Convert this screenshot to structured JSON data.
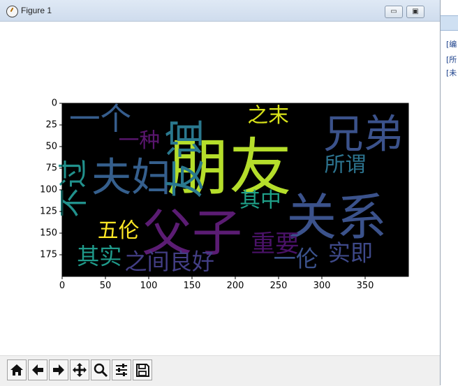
{
  "window": {
    "title": "Figure 1",
    "buttons": {
      "minimize": "▭",
      "maximize": "▣",
      "close": "✕"
    }
  },
  "plot": {
    "image_width": 400,
    "image_height": 200,
    "x_ticks": [
      "0",
      "50",
      "100",
      "150",
      "200",
      "250",
      "300",
      "350"
    ],
    "y_ticks": [
      "0",
      "25",
      "50",
      "75",
      "100",
      "125",
      "150",
      "175"
    ],
    "background": "#000000"
  },
  "words": [
    {
      "text": "朋友",
      "x": 193,
      "y": 75,
      "size": 72,
      "color": "#b5de2b",
      "vertical": false
    },
    {
      "text": "父子",
      "x": 150,
      "y": 150,
      "size": 58,
      "color": "#5b1c73",
      "vertical": false
    },
    {
      "text": "关系",
      "x": 317,
      "y": 132,
      "size": 58,
      "color": "#3b528b",
      "vertical": false
    },
    {
      "text": "兄弟",
      "x": 348,
      "y": 36,
      "size": 46,
      "color": "#3b528b",
      "vertical": false
    },
    {
      "text": "夫妇",
      "x": 80,
      "y": 86,
      "size": 46,
      "color": "#355f8d",
      "vertical": false
    },
    {
      "text": "友谊",
      "x": 143,
      "y": 64,
      "size": 46,
      "color": "#2a788e",
      "vertical": true
    },
    {
      "text": "一个",
      "x": 44,
      "y": 18,
      "size": 36,
      "color": "#365d8d",
      "vertical": false
    },
    {
      "text": "不过",
      "x": 13,
      "y": 98,
      "size": 34,
      "color": "#21918c",
      "vertical": true
    },
    {
      "text": "一种",
      "x": 89,
      "y": 43,
      "size": 24,
      "color": "#5a166f",
      "vertical": false
    },
    {
      "text": "之末",
      "x": 238,
      "y": 14,
      "size": 24,
      "color": "#d8e219",
      "vertical": false
    },
    {
      "text": "所谓",
      "x": 327,
      "y": 71,
      "size": 24,
      "color": "#2c738e",
      "vertical": false
    },
    {
      "text": "其中",
      "x": 229,
      "y": 112,
      "size": 24,
      "color": "#1fa088",
      "vertical": false
    },
    {
      "text": "五伦",
      "x": 65,
      "y": 147,
      "size": 24,
      "color": "#fde725",
      "vertical": false
    },
    {
      "text": "重要",
      "x": 246,
      "y": 163,
      "size": 28,
      "color": "#4a1268",
      "vertical": false
    },
    {
      "text": "其实",
      "x": 43,
      "y": 177,
      "size": 26,
      "color": "#1f9a8a",
      "vertical": false
    },
    {
      "text": "之间良好",
      "x": 124,
      "y": 183,
      "size": 26,
      "color": "#433e85",
      "vertical": false
    },
    {
      "text": "一伦",
      "x": 270,
      "y": 180,
      "size": 26,
      "color": "#3b528b",
      "vertical": false
    },
    {
      "text": "实即",
      "x": 333,
      "y": 173,
      "size": 26,
      "color": "#3e4989",
      "vertical": false
    }
  ],
  "toolbar": {
    "home_icon": "home-icon",
    "back_icon": "arrow-left-icon",
    "forward_icon": "arrow-right-icon",
    "pan_icon": "move-icon",
    "zoom_icon": "zoom-icon",
    "configure_icon": "sliders-icon",
    "save_icon": "save-icon"
  },
  "side_panel": {
    "items": [
      "[编",
      "[所",
      "[未"
    ]
  }
}
